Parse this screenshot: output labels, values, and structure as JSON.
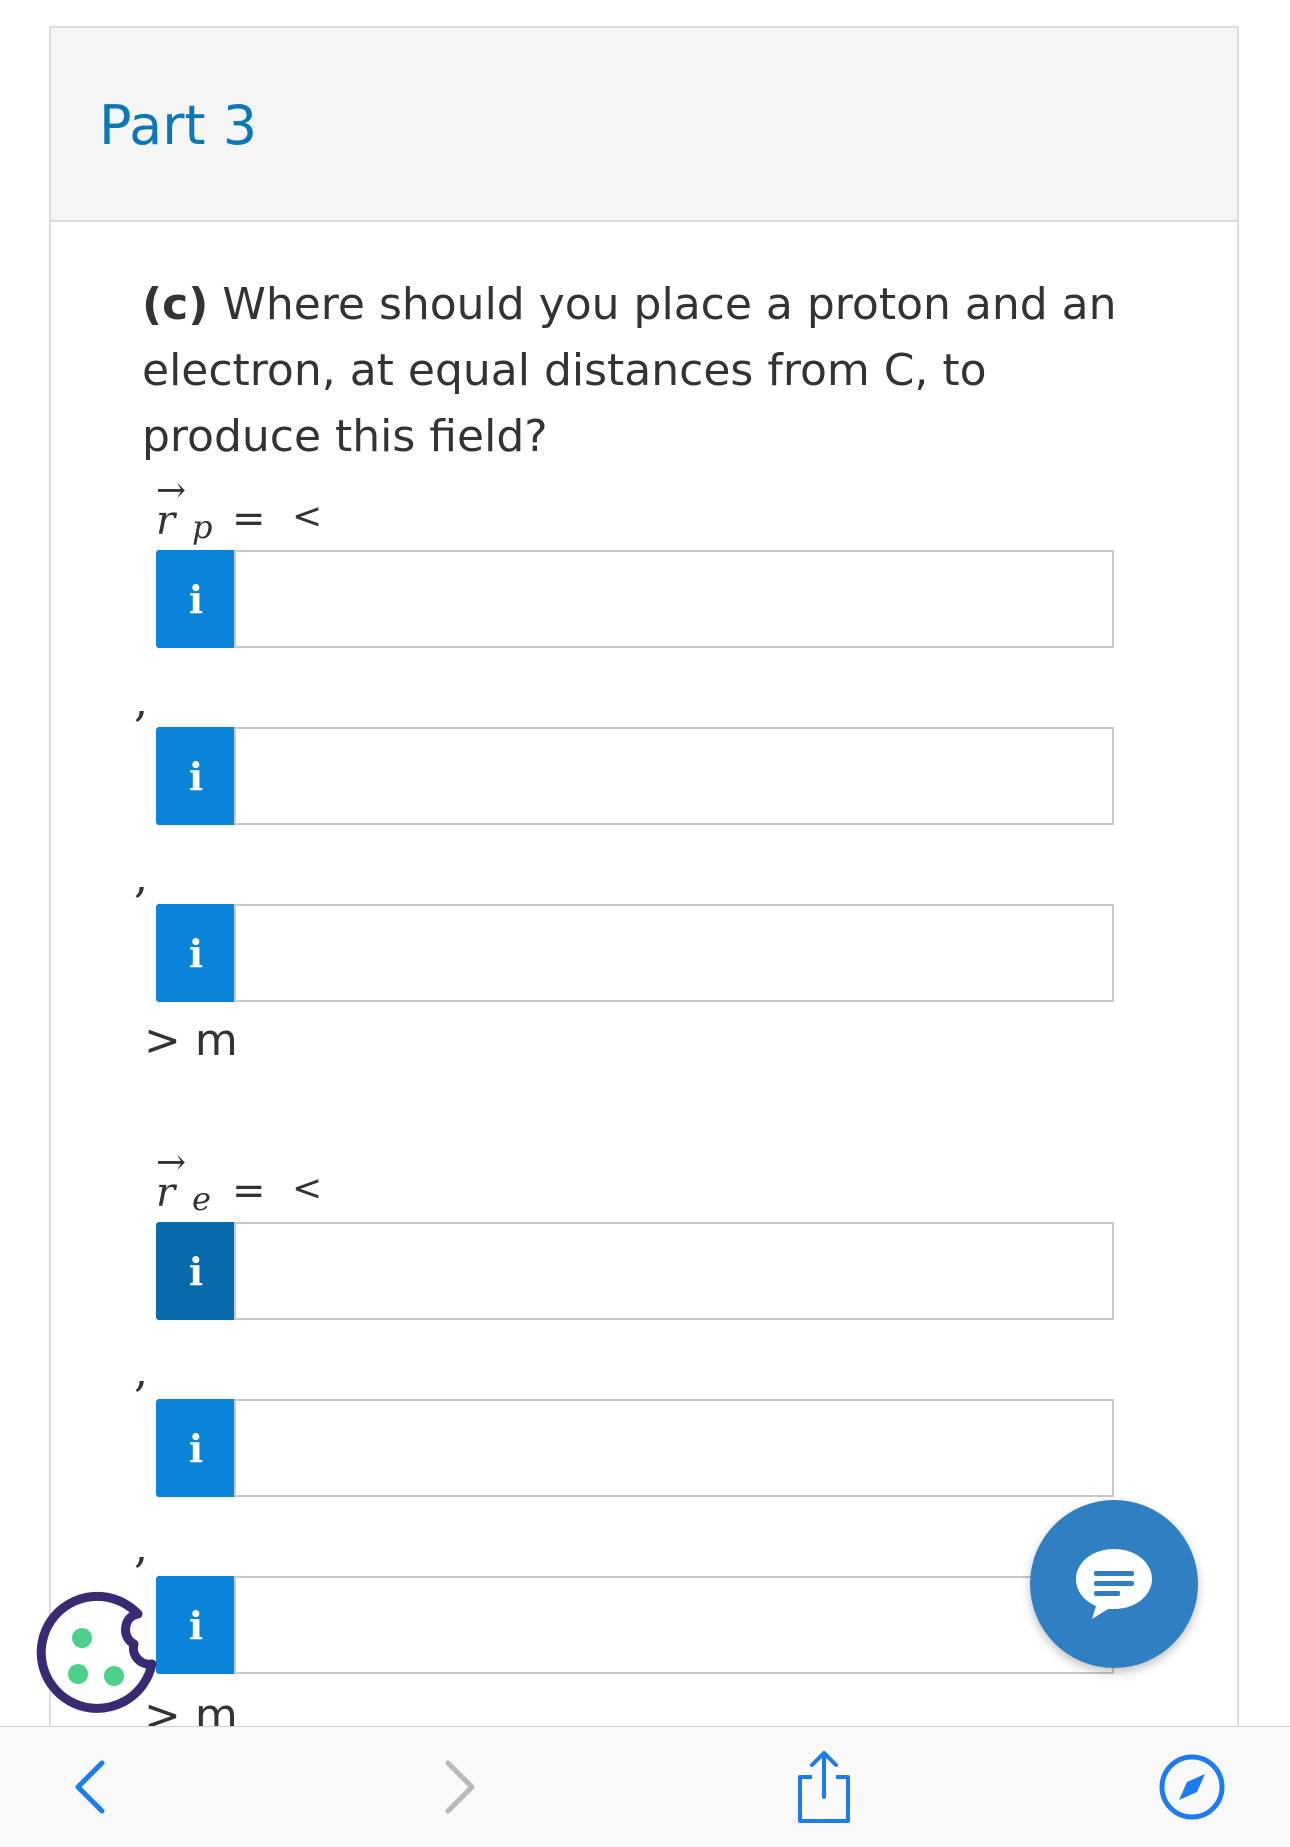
{
  "part": {
    "title": "Part 3"
  },
  "question": {
    "label": "(c)",
    "text": "Where should you place a proton and an electron, at equal distances from C, to produce this field?"
  },
  "proton_vector": {
    "symbol": "r",
    "subscript": "p",
    "equals": "=",
    "open": "<",
    "fields": [
      {
        "info": "i",
        "value": ""
      },
      {
        "info": "i",
        "value": ""
      },
      {
        "info": "i",
        "value": ""
      }
    ],
    "separator": ",",
    "close_unit": "> m"
  },
  "electron_vector": {
    "symbol": "r",
    "subscript": "e",
    "equals": "=",
    "open": "<",
    "fields": [
      {
        "info": "i",
        "value": ""
      },
      {
        "info": "i",
        "value": ""
      },
      {
        "info": "i",
        "value": ""
      }
    ],
    "separator": ",",
    "close_unit": "> m"
  },
  "colors": {
    "title": "#0a77b6",
    "info_button": "#0a84d8",
    "info_button_active": "#066aad",
    "chat_button": "#2f7fc2",
    "toolbar_icon": "#1a7cf0",
    "cookie_outline": "#3a2a73",
    "cookie_dots": "#4cd08a"
  },
  "icons": {
    "cookie": "cookie-icon",
    "chat": "chat-bubble-icon",
    "back": "chevron-left-icon",
    "forward": "chevron-right-icon",
    "share": "share-icon",
    "browser": "compass-icon"
  }
}
